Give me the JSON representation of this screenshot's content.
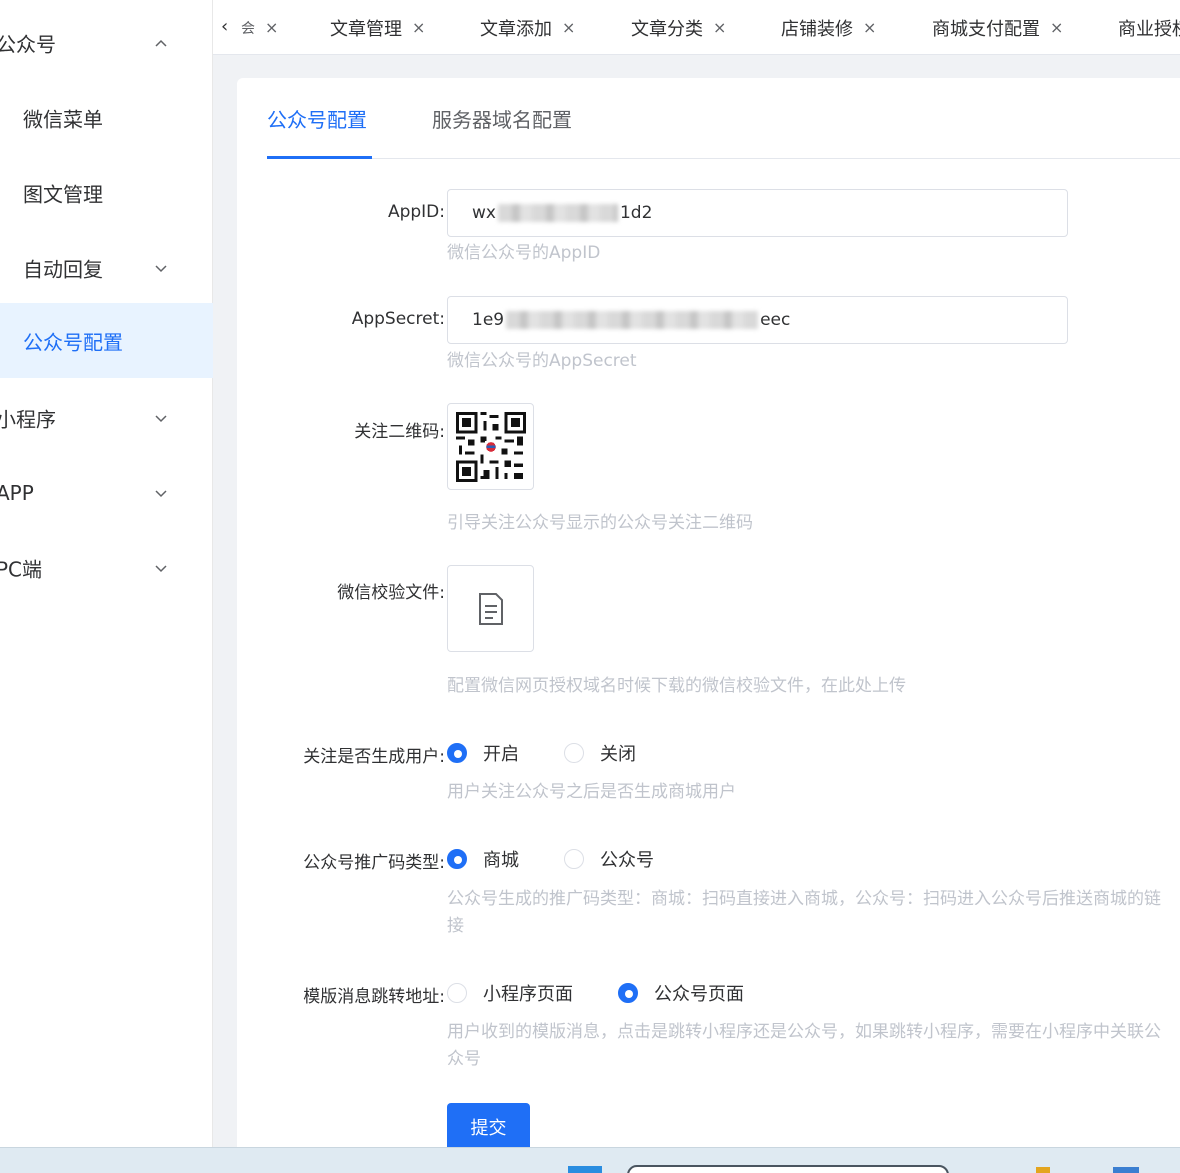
{
  "sidebar": {
    "items": [
      {
        "label": "公众号",
        "expanded": true
      },
      {
        "label": "微信菜单"
      },
      {
        "label": "图文管理"
      },
      {
        "label": "自动回复"
      },
      {
        "label": "公众号配置",
        "active": true
      },
      {
        "label": "小程序"
      },
      {
        "label": "APP"
      },
      {
        "label": "PC端"
      }
    ]
  },
  "tabbar": {
    "back_icon": "chevron-left-icon",
    "partial_tab": "会",
    "tabs": [
      {
        "label": "文章管理"
      },
      {
        "label": "文章添加"
      },
      {
        "label": "文章分类"
      },
      {
        "label": "店铺装修"
      },
      {
        "label": "商城支付配置"
      },
      {
        "label": "商业授权"
      }
    ],
    "close_glyph": "×"
  },
  "config_tabs": [
    {
      "label": "公众号配置",
      "active": true
    },
    {
      "label": "服务器域名配置"
    }
  ],
  "form": {
    "appid": {
      "label": "AppID:",
      "prefix": "wx",
      "suffix": "1d2",
      "help": "微信公众号的AppID"
    },
    "appsecret": {
      "label": "AppSecret:",
      "prefix": "1e9",
      "suffix": "eec",
      "help": "微信公众号的AppSecret"
    },
    "qrcode": {
      "label": "关注二维码:",
      "help": "引导关注公众号显示的公众号关注二维码"
    },
    "verify_file": {
      "label": "微信校验文件:",
      "icon": "document-icon",
      "help": "配置微信网页授权域名时候下载的微信校验文件，在此处上传"
    },
    "follow_create_user": {
      "label": "关注是否生成用户:",
      "options": [
        "开启",
        "关闭"
      ],
      "selected": "开启",
      "help": "用户关注公众号之后是否生成商城用户"
    },
    "promo_code_type": {
      "label": "公众号推广码类型:",
      "options": [
        "商城",
        "公众号"
      ],
      "selected": "商城",
      "help": "公众号生成的推广码类型：商城：扫码直接进入商城，公众号：扫码进入公众号后推送商城的链接"
    },
    "template_jump": {
      "label": "模版消息跳转地址:",
      "options": [
        "小程序页面",
        "公众号页面"
      ],
      "selected": "公众号页面",
      "help": "用户收到的模版消息，点击是跳转小程序还是公众号，如果跳转小程序，需要在小程序中关联公众号"
    },
    "submit_label": "提交"
  },
  "colors": {
    "accent": "#1f6ff6",
    "help_text": "#c0c4cc",
    "active_bg": "#e8f3ff"
  }
}
